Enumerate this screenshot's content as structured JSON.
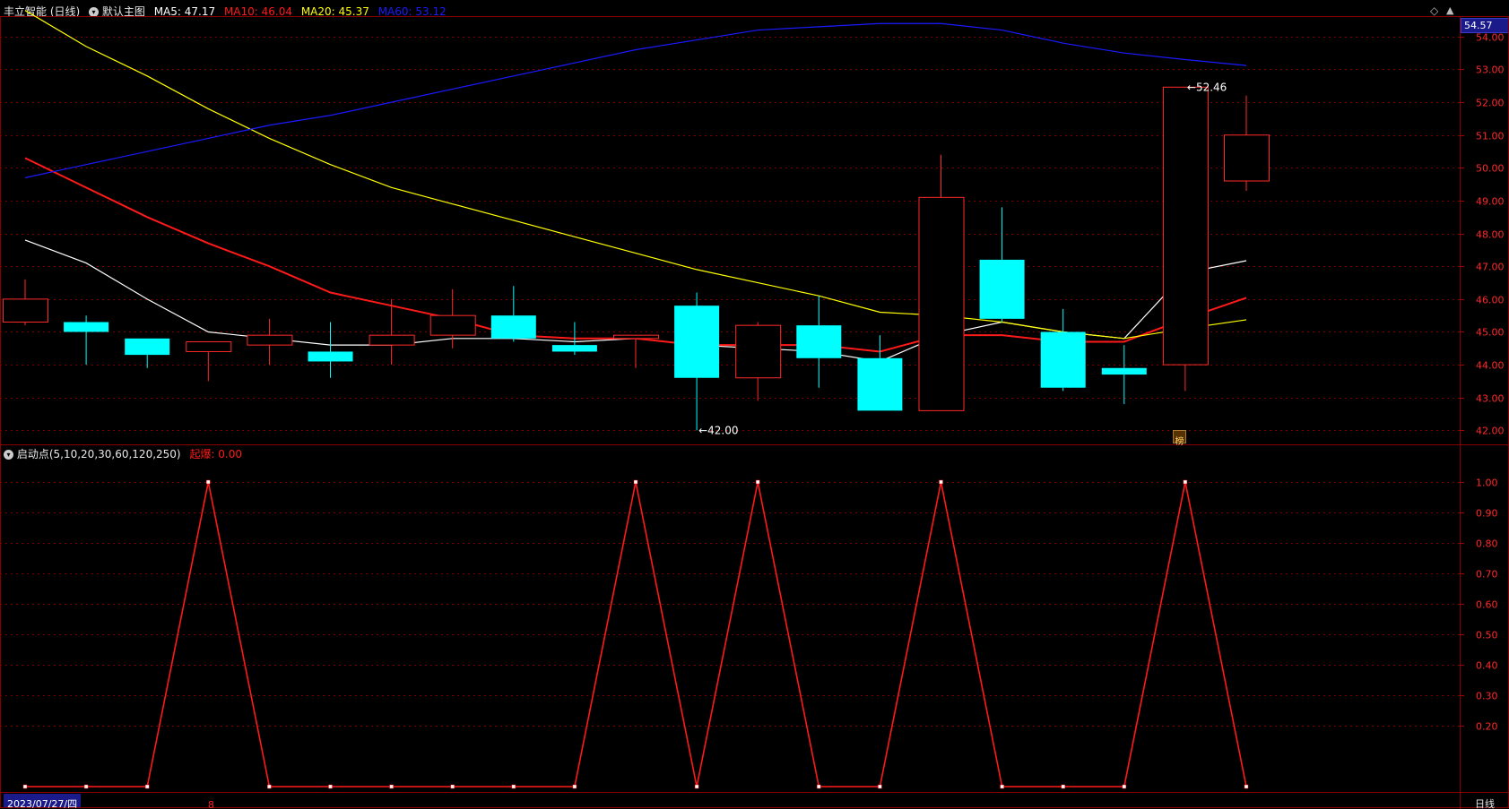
{
  "header": {
    "stock_title": "丰立智能 (日线)",
    "panel_name": "默认主图",
    "ma5_label": "MA5: 47.17",
    "ma10_label": "MA10: 46.04",
    "ma20_label": "MA20: 45.37",
    "ma60_label": "MA60: 53.12",
    "colors": {
      "ma5": "#ffffff",
      "ma10": "#ff1a1a",
      "ma20": "#ffff00",
      "ma60": "#1a1aff"
    }
  },
  "top_right_price": "54.57",
  "sub_header": {
    "indicator_label": "启动点(5,10,20,30,60,120,250)",
    "signal_label": "起爆: 0.00"
  },
  "footer": {
    "date": "2023/07/27/四",
    "marker": "8",
    "period": "日线"
  },
  "chart_badge": "榜",
  "chart_data": [
    {
      "type": "candlestick",
      "ylim": [
        41.6,
        54.57
      ],
      "yticks": [
        42,
        43,
        44,
        45,
        46,
        47,
        48,
        49,
        50,
        51,
        52,
        53,
        54
      ],
      "ytick_labels": [
        "42.00",
        "43.00",
        "44.00",
        "45.00",
        "46.00",
        "47.00",
        "48.00",
        "49.00",
        "50.00",
        "51.00",
        "52.00",
        "53.00",
        "54.00"
      ],
      "candles": [
        {
          "o": 45.3,
          "h": 46.6,
          "l": 45.2,
          "c": 46.0
        },
        {
          "o": 45.3,
          "h": 45.5,
          "l": 44.0,
          "c": 45.0
        },
        {
          "o": 44.8,
          "h": 44.8,
          "l": 43.9,
          "c": 44.3
        },
        {
          "o": 44.4,
          "h": 44.7,
          "l": 43.5,
          "c": 44.7
        },
        {
          "o": 44.6,
          "h": 45.4,
          "l": 44.0,
          "c": 44.9
        },
        {
          "o": 44.4,
          "h": 45.3,
          "l": 43.6,
          "c": 44.1
        },
        {
          "o": 44.6,
          "h": 46.0,
          "l": 44.0,
          "c": 44.9
        },
        {
          "o": 44.9,
          "h": 46.3,
          "l": 44.5,
          "c": 45.5
        },
        {
          "o": 45.5,
          "h": 46.4,
          "l": 44.7,
          "c": 44.8
        },
        {
          "o": 44.6,
          "h": 45.3,
          "l": 44.3,
          "c": 44.4
        },
        {
          "o": 44.8,
          "h": 44.9,
          "l": 43.9,
          "c": 44.9
        },
        {
          "o": 45.8,
          "h": 46.2,
          "l": 42.0,
          "c": 43.6
        },
        {
          "o": 43.6,
          "h": 45.3,
          "l": 42.9,
          "c": 45.2
        },
        {
          "o": 45.2,
          "h": 46.1,
          "l": 43.3,
          "c": 44.2
        },
        {
          "o": 44.2,
          "h": 44.9,
          "l": 42.6,
          "c": 42.6
        },
        {
          "o": 42.6,
          "h": 50.4,
          "l": 42.6,
          "c": 49.1
        },
        {
          "o": 47.2,
          "h": 48.8,
          "l": 45.3,
          "c": 45.4
        },
        {
          "o": 45.0,
          "h": 45.7,
          "l": 43.2,
          "c": 43.3
        },
        {
          "o": 43.9,
          "h": 44.6,
          "l": 42.8,
          "c": 43.7
        },
        {
          "o": 44.0,
          "h": 52.46,
          "l": 43.2,
          "c": 52.46
        },
        {
          "o": 49.6,
          "h": 52.2,
          "l": 49.3,
          "c": 51.0
        }
      ],
      "series": [
        {
          "name": "MA5",
          "color": "#ffffff",
          "values": [
            47.8,
            47.1,
            46.0,
            45.0,
            44.8,
            44.6,
            44.6,
            44.8,
            44.8,
            44.7,
            44.8,
            44.6,
            44.5,
            44.4,
            44.1,
            44.9,
            45.3,
            45.0,
            44.8,
            46.8,
            47.17
          ]
        },
        {
          "name": "MA10",
          "color": "#ff1a1a",
          "values": [
            50.3,
            49.4,
            48.5,
            47.7,
            47.0,
            46.2,
            45.8,
            45.4,
            44.9,
            44.8,
            44.8,
            44.6,
            44.6,
            44.6,
            44.4,
            44.9,
            44.9,
            44.7,
            44.7,
            45.4,
            46.04
          ]
        },
        {
          "name": "MA20",
          "color": "#ffff00",
          "values": [
            54.8,
            53.7,
            52.8,
            51.8,
            50.9,
            50.1,
            49.4,
            48.9,
            48.4,
            47.9,
            47.4,
            46.9,
            46.5,
            46.1,
            45.6,
            45.5,
            45.3,
            45.0,
            44.8,
            45.1,
            45.37
          ]
        },
        {
          "name": "MA60",
          "color": "#1a1aff",
          "values": [
            49.7,
            50.1,
            50.5,
            50.9,
            51.3,
            51.6,
            52.0,
            52.4,
            52.8,
            53.2,
            53.6,
            53.9,
            54.2,
            54.3,
            54.4,
            54.4,
            54.2,
            53.8,
            53.5,
            53.3,
            53.12
          ]
        }
      ],
      "annotations": [
        {
          "text": "52.46",
          "index": 19,
          "value": 52.46
        },
        {
          "text": "42.00",
          "index": 11,
          "value": 42.0
        }
      ]
    },
    {
      "type": "line",
      "title": "启动点(5,10,20,30,60,120,250)",
      "ylim": [
        0,
        1.05
      ],
      "yticks": [
        0.2,
        0.3,
        0.4,
        0.5,
        0.6,
        0.7,
        0.8,
        0.9,
        1.0
      ],
      "ytick_labels": [
        "0.20",
        "0.30",
        "0.40",
        "0.50",
        "0.60",
        "0.70",
        "0.80",
        "0.90",
        "1.00"
      ],
      "series": [
        {
          "name": "起爆",
          "color": "#ff1a1a",
          "values": [
            0,
            0,
            0,
            1,
            0,
            0,
            0,
            0,
            0,
            0,
            1,
            0,
            1,
            0,
            0,
            1,
            0,
            0,
            0,
            1,
            0
          ]
        }
      ]
    }
  ]
}
